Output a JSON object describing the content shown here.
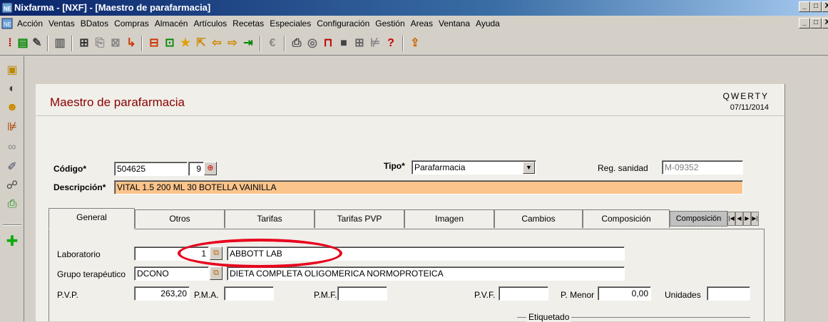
{
  "window": {
    "title": "Nixfarma - [NXF] - [Maestro de parafarmacia]",
    "controls": [
      "_",
      "□",
      "X"
    ]
  },
  "menu": {
    "items": [
      "Acción",
      "Ventas",
      "BDatos",
      "Compras",
      "Almacén",
      "Artículos",
      "Recetas",
      "Especiales",
      "Configuración",
      "Gestión",
      "Areas",
      "Ventana",
      "Ayuda"
    ]
  },
  "header": {
    "title": "Maestro de parafarmacia",
    "company": "QWERTY",
    "date": "07/11/2014"
  },
  "form": {
    "codigo_label": "Código*",
    "codigo_value": "504625",
    "codigo_check": "9",
    "tipo_label": "Tipo*",
    "tipo_value": "Parafarmacia",
    "reg_sanidad_label": "Reg. sanidad",
    "reg_sanidad_value": "M-09352",
    "descripcion_label": "Descripción*",
    "descripcion_value": "VITAL 1.5  200 ML 30 BOTELLA VAINILLA"
  },
  "tabs": [
    "General",
    "Otros",
    "Tarifas",
    "Tarifas PVP",
    "Imagen",
    "Cambios",
    "Composición",
    "Composición"
  ],
  "general": {
    "laboratorio_label": "Laboratorio",
    "laboratorio_code": "1",
    "laboratorio_name": "ABBOTT LAB",
    "grupo_label": "Grupo terapéutico",
    "grupo_code": "DCONO",
    "grupo_name": "DIETA COMPLETA OLIGOMERICA NORMOPROTEICA",
    "pvp_label": "P.V.P.",
    "pvp_value": "263,20",
    "pma_label": "P.M.A.",
    "pma_value": "",
    "pmf_label": "P.M.F.",
    "pmf_value": "",
    "pvf_label": "P.V.F.",
    "pvf_value": "",
    "pmenor_label": "P. Menor",
    "pmenor_value": "0,00",
    "unidades_label": "Unidades",
    "unidades_value": "",
    "etiquetado_label": "Etiquetado"
  },
  "colors": {
    "title_red": "#8b0000",
    "description_bg": "#fbc48c",
    "highlight": "#e8001c"
  }
}
